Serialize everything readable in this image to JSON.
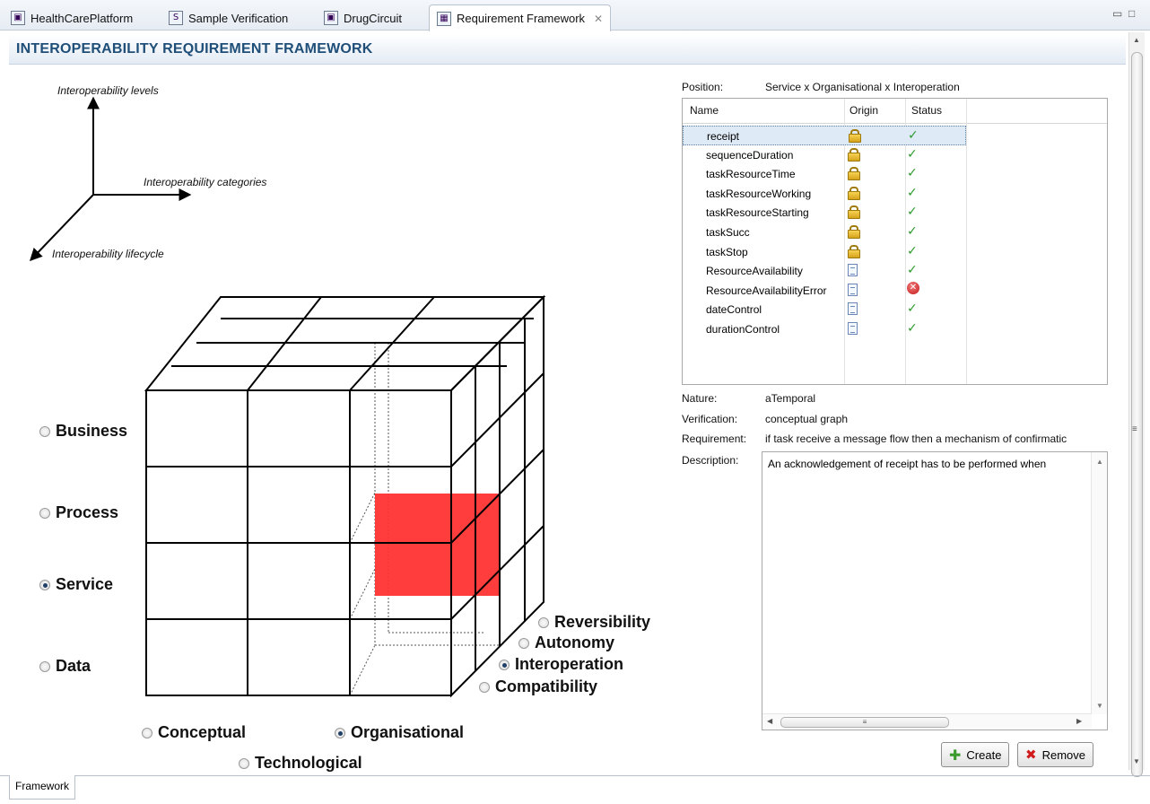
{
  "tabs": [
    {
      "label": "HealthCarePlatform",
      "icon": "model-icon"
    },
    {
      "label": "Sample Verification",
      "icon": "s-file-icon"
    },
    {
      "label": "DrugCircuit",
      "icon": "model-icon"
    },
    {
      "label": "Requirement Framework",
      "icon": "cube-icon",
      "active": true
    }
  ],
  "header": {
    "title": "INTEROPERABILITY REQUIREMENT FRAMEWORK"
  },
  "axes": {
    "levels": "Interoperability levels",
    "categories": "Interoperability categories",
    "lifecycle": "Interoperability lifecycle"
  },
  "levels": [
    {
      "label": "Business",
      "checked": false
    },
    {
      "label": "Process",
      "checked": false
    },
    {
      "label": "Service",
      "checked": true
    },
    {
      "label": "Data",
      "checked": false
    }
  ],
  "categories": [
    {
      "label": "Conceptual",
      "checked": false
    },
    {
      "label": "Organisational",
      "checked": true
    },
    {
      "label": "Technological",
      "checked": false
    }
  ],
  "lifecycle": [
    {
      "label": "Reversibility",
      "checked": false
    },
    {
      "label": "Autonomy",
      "checked": false
    },
    {
      "label": "Interoperation",
      "checked": true
    },
    {
      "label": "Compatibility",
      "checked": false
    }
  ],
  "highlight_color": "#ff3333",
  "position": {
    "label": "Position:",
    "value": "Service x Organisational x Interoperation"
  },
  "table": {
    "headers": [
      "Name",
      "Origin",
      "Status"
    ],
    "rows": [
      {
        "name": "receipt",
        "origin": "lock-icon",
        "status": "check-icon",
        "selected": true
      },
      {
        "name": "sequenceDuration",
        "origin": "lock-icon",
        "status": "check-icon"
      },
      {
        "name": "taskResourceTime",
        "origin": "lock-icon",
        "status": "check-icon"
      },
      {
        "name": "taskResourceWorking",
        "origin": "lock-icon",
        "status": "check-icon"
      },
      {
        "name": "taskResourceStarting",
        "origin": "lock-icon",
        "status": "check-icon"
      },
      {
        "name": "taskSucc",
        "origin": "lock-icon",
        "status": "check-icon"
      },
      {
        "name": "taskStop",
        "origin": "lock-icon",
        "status": "check-icon"
      },
      {
        "name": "ResourceAvailability",
        "origin": "document-icon",
        "status": "check-icon"
      },
      {
        "name": "ResourceAvailabilityError",
        "origin": "document-icon",
        "status": "error-icon"
      },
      {
        "name": "dateControl",
        "origin": "document-icon",
        "status": "check-icon"
      },
      {
        "name": "durationControl",
        "origin": "document-icon",
        "status": "check-icon"
      }
    ]
  },
  "details": {
    "nature_label": "Nature:",
    "nature": "aTemporal",
    "verification_label": "Verification:",
    "verification": "conceptual graph",
    "requirement_label": "Requirement:",
    "requirement": "if task receive a message flow then a mechanism of confirmatic",
    "description_label": "Description:",
    "description": "An acknowledgement of receipt has to be performed when"
  },
  "buttons": {
    "create": "Create",
    "remove": "Remove"
  },
  "bottom_tab": "Framework"
}
